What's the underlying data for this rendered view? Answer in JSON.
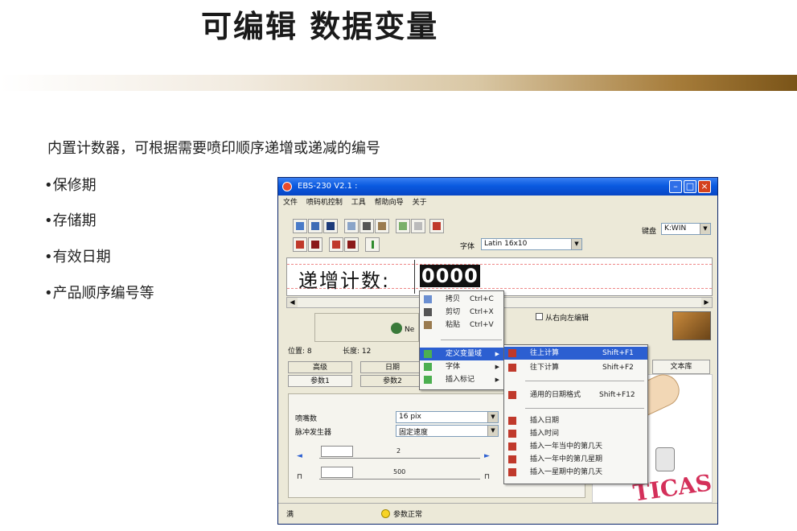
{
  "slide": {
    "title": "可编辑 数据变量",
    "intro": "内置计数器，可根据需要喷印顺序递增或递减的编号",
    "bullets": [
      "•保修期",
      "•存储期",
      "•有效日期",
      "•产品顺序编号等"
    ]
  },
  "app": {
    "title": "EBS-230 V2.1 :",
    "menu": [
      "文件",
      "喷码机控制",
      "工具",
      "帮助向导",
      "关于"
    ],
    "font_label": "字体",
    "font_value": "Latin 16x10",
    "keyboard_label": "键盘",
    "keyboard_value": "K:WIN",
    "editor_text": "递增计数:",
    "counter_text": "0000",
    "run_label": "Ne",
    "checkbox_label": "从右向左编辑",
    "position_label": "位置: 8",
    "length_label": "长度: 12",
    "tabs": {
      "advanced": "高级",
      "date": "日期",
      "param1": "参数1",
      "param2": "参数2"
    },
    "right_tab": "文本库",
    "params": {
      "nozzle_label": "喷嘴数",
      "nozzle_value": "16 pix",
      "pulse_label": "脉冲发生器",
      "pulse_value": "固定速度",
      "slider1_value": "2",
      "slider2_value": "500"
    },
    "art_text": "TICAS",
    "status_left": "满",
    "status_mid": "参数正常"
  },
  "context_menu": {
    "items": [
      {
        "label": "拷贝",
        "shortcut": "Ctrl+C"
      },
      {
        "label": "剪切",
        "shortcut": "Ctrl+X"
      },
      {
        "label": "粘贴",
        "shortcut": "Ctrl+V"
      },
      {
        "label": "定义变量域"
      },
      {
        "label": "字体"
      },
      {
        "label": "插入标记"
      }
    ]
  },
  "submenu": {
    "items": [
      {
        "label": "往上计算",
        "shortcut": "Shift+F1"
      },
      {
        "label": "往下计算",
        "shortcut": "Shift+F2"
      },
      {
        "label": "通用的日期格式",
        "shortcut": "Shift+F12"
      },
      {
        "label": "插入日期"
      },
      {
        "label": "插入时间"
      },
      {
        "label": "插入一年当中的第几天"
      },
      {
        "label": "插入一年中的第几星期"
      },
      {
        "label": "插入一星期中的第几天"
      }
    ]
  },
  "colors": {
    "accent": "#2c5fd1",
    "title_bar_end": "#7a5418",
    "counter_bg": "#111111"
  }
}
